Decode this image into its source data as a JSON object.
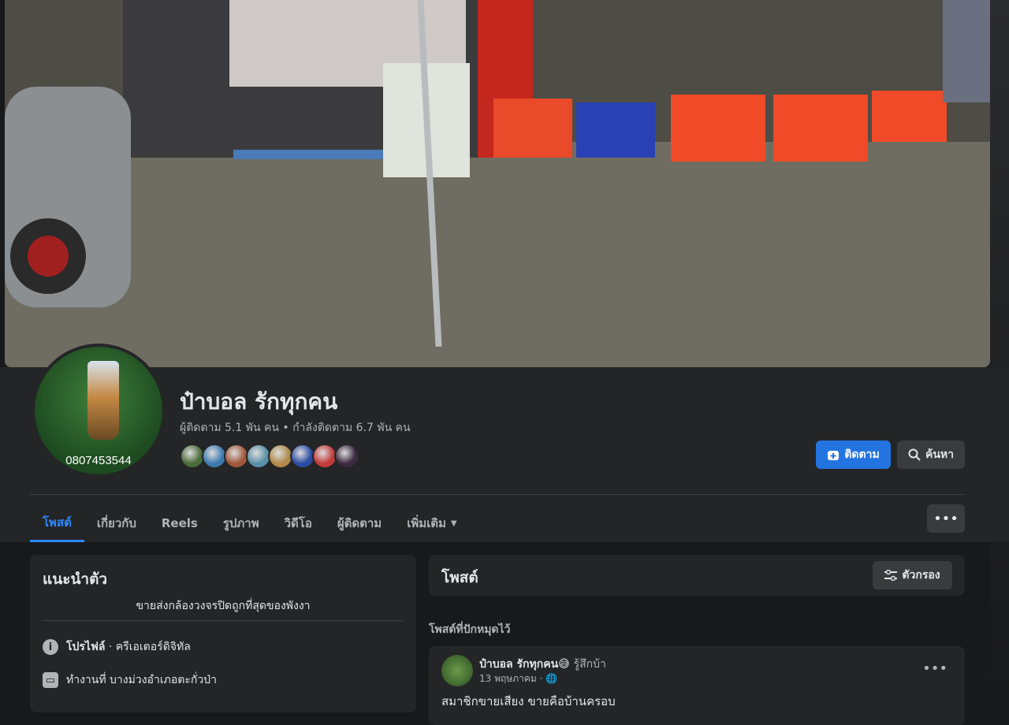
{
  "page": {
    "name": "ป๋าบอล รักทุกคน",
    "stats": "ผู้ติดตาม 5.1 พัน คน • กำลังติดตาม 6.7 พัน คน",
    "avatar_phone": "0807453544",
    "follow_label": "ติดตาม",
    "search_label": "ค้นหา"
  },
  "tabs": [
    {
      "label": "โพสต์"
    },
    {
      "label": "เกี่ยวกับ"
    },
    {
      "label": "Reels"
    },
    {
      "label": "รูปภาพ"
    },
    {
      "label": "วิดีโอ"
    },
    {
      "label": "ผู้ติดตาม"
    },
    {
      "label": "เพิ่มเติม"
    }
  ],
  "friend_colors": [
    "#4a6b3a",
    "#3c7bb0",
    "#a0583c",
    "#5a8fa8",
    "#b08a4a",
    "#2b4ca3",
    "#c23a3a",
    "#3b2a40"
  ],
  "intro": {
    "title": "แนะนำตัว",
    "bio": "ขายส่งกล้องวงจรปิดถูกที่สุดของพังงา",
    "profile_label": "โปรไฟล์",
    "profile_type": " · ครีเอเตอร์ดิจิทัล",
    "work": "ทำงานที่ บางม่วงอำเภอตะกั่วป่า"
  },
  "posts": {
    "title": "โพสต์",
    "filter_label": "ตัวกรอง",
    "pinned_label": "โพสต์ที่ปักหมุดไว้",
    "post": {
      "author": "ป๋าบอล รักทุกคน😅",
      "feeling": "รู้สึกบ้า",
      "date": "13 พฤษภาคม ·",
      "text": "สมาชิกขายเสียง ขายคือบ้านครอบ"
    }
  }
}
